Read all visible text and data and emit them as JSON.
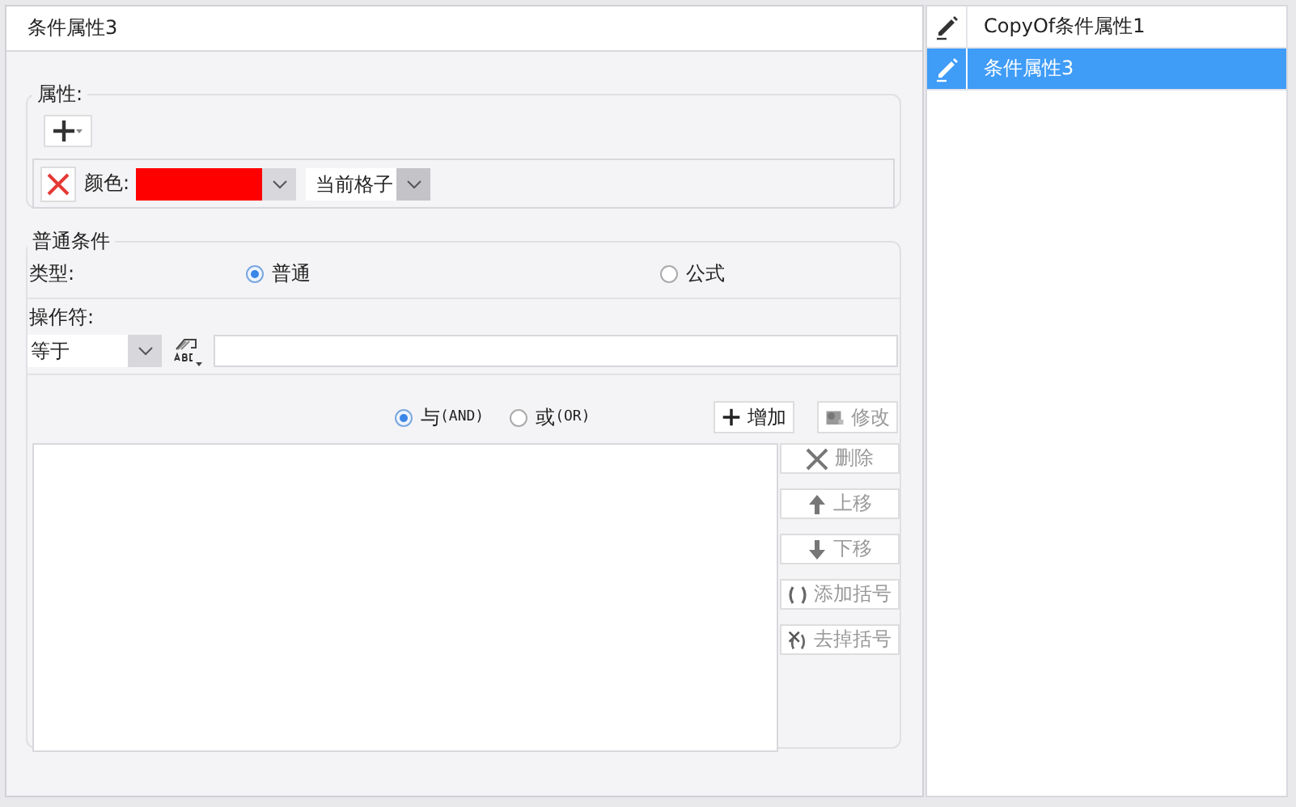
{
  "dialog": {
    "title": "条件属性3"
  },
  "attributes": {
    "legend": "属性:",
    "items": [
      {
        "label": "颜色:",
        "color": "#ff0000",
        "scope": "当前格子"
      }
    ]
  },
  "conditions": {
    "legend": "普通条件",
    "type_label": "类型:",
    "type_options": [
      {
        "label": "普通",
        "selected": true
      },
      {
        "label": "公式",
        "selected": false
      }
    ],
    "operator_label": "操作符:",
    "operator": "等于",
    "logic_options": [
      {
        "label": "与",
        "code": "(AND)",
        "selected": true
      },
      {
        "label": "或",
        "code": "(OR)",
        "selected": false
      }
    ],
    "top_buttons": [
      {
        "kind": "add",
        "label": "增加",
        "disabled": false
      },
      {
        "kind": "edit",
        "label": "修改",
        "disabled": true
      }
    ],
    "side_buttons": [
      {
        "kind": "delete",
        "label": "删除",
        "disabled": true
      },
      {
        "kind": "up",
        "label": "上移",
        "disabled": true
      },
      {
        "kind": "down",
        "label": "下移",
        "disabled": true
      },
      {
        "kind": "add-paren",
        "label": "添加括号",
        "disabled": true
      },
      {
        "kind": "remove-paren",
        "label": "去掉括号",
        "disabled": true
      }
    ]
  },
  "condition_list": [
    {
      "label": "CopyOf条件属性1",
      "selected": false
    },
    {
      "label": "条件属性3",
      "selected": true
    }
  ]
}
